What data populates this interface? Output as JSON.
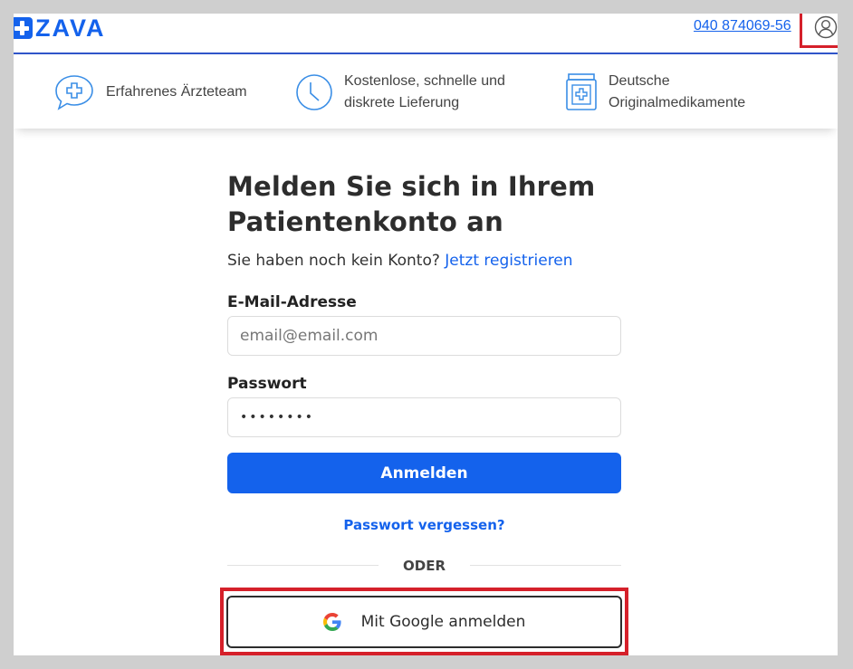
{
  "header": {
    "logo_text": "ZAVA",
    "phone": "040 874069-56",
    "account_icon": "user-circle-icon"
  },
  "features": [
    {
      "icon": "chat-cross-icon",
      "line1": "Erfahrenes Ärzteteam",
      "line2": ""
    },
    {
      "icon": "clock-icon",
      "line1": "Kostenlose, schnelle und",
      "line2": "diskrete Lieferung"
    },
    {
      "icon": "medicine-jar-icon",
      "line1": "Deutsche",
      "line2": "Originalmedikamente"
    }
  ],
  "login": {
    "title_line1": "Melden Sie sich in Ihrem",
    "title_line2": "Patientenkonto an",
    "no_account_text": "Sie haben noch kein Konto?",
    "register_link": "Jetzt registrieren",
    "email_label": "E-Mail-Adresse",
    "email_placeholder": "email@email.com",
    "password_label": "Passwort",
    "password_value": "••••••••",
    "submit_label": "Anmelden",
    "forgot_link": "Passwort vergessen?",
    "divider_text": "ODER",
    "google_label": "Mit Google anmelden"
  },
  "colors": {
    "brand": "#1462ec",
    "highlight": "#d5202a",
    "text": "#2d2d2d"
  }
}
